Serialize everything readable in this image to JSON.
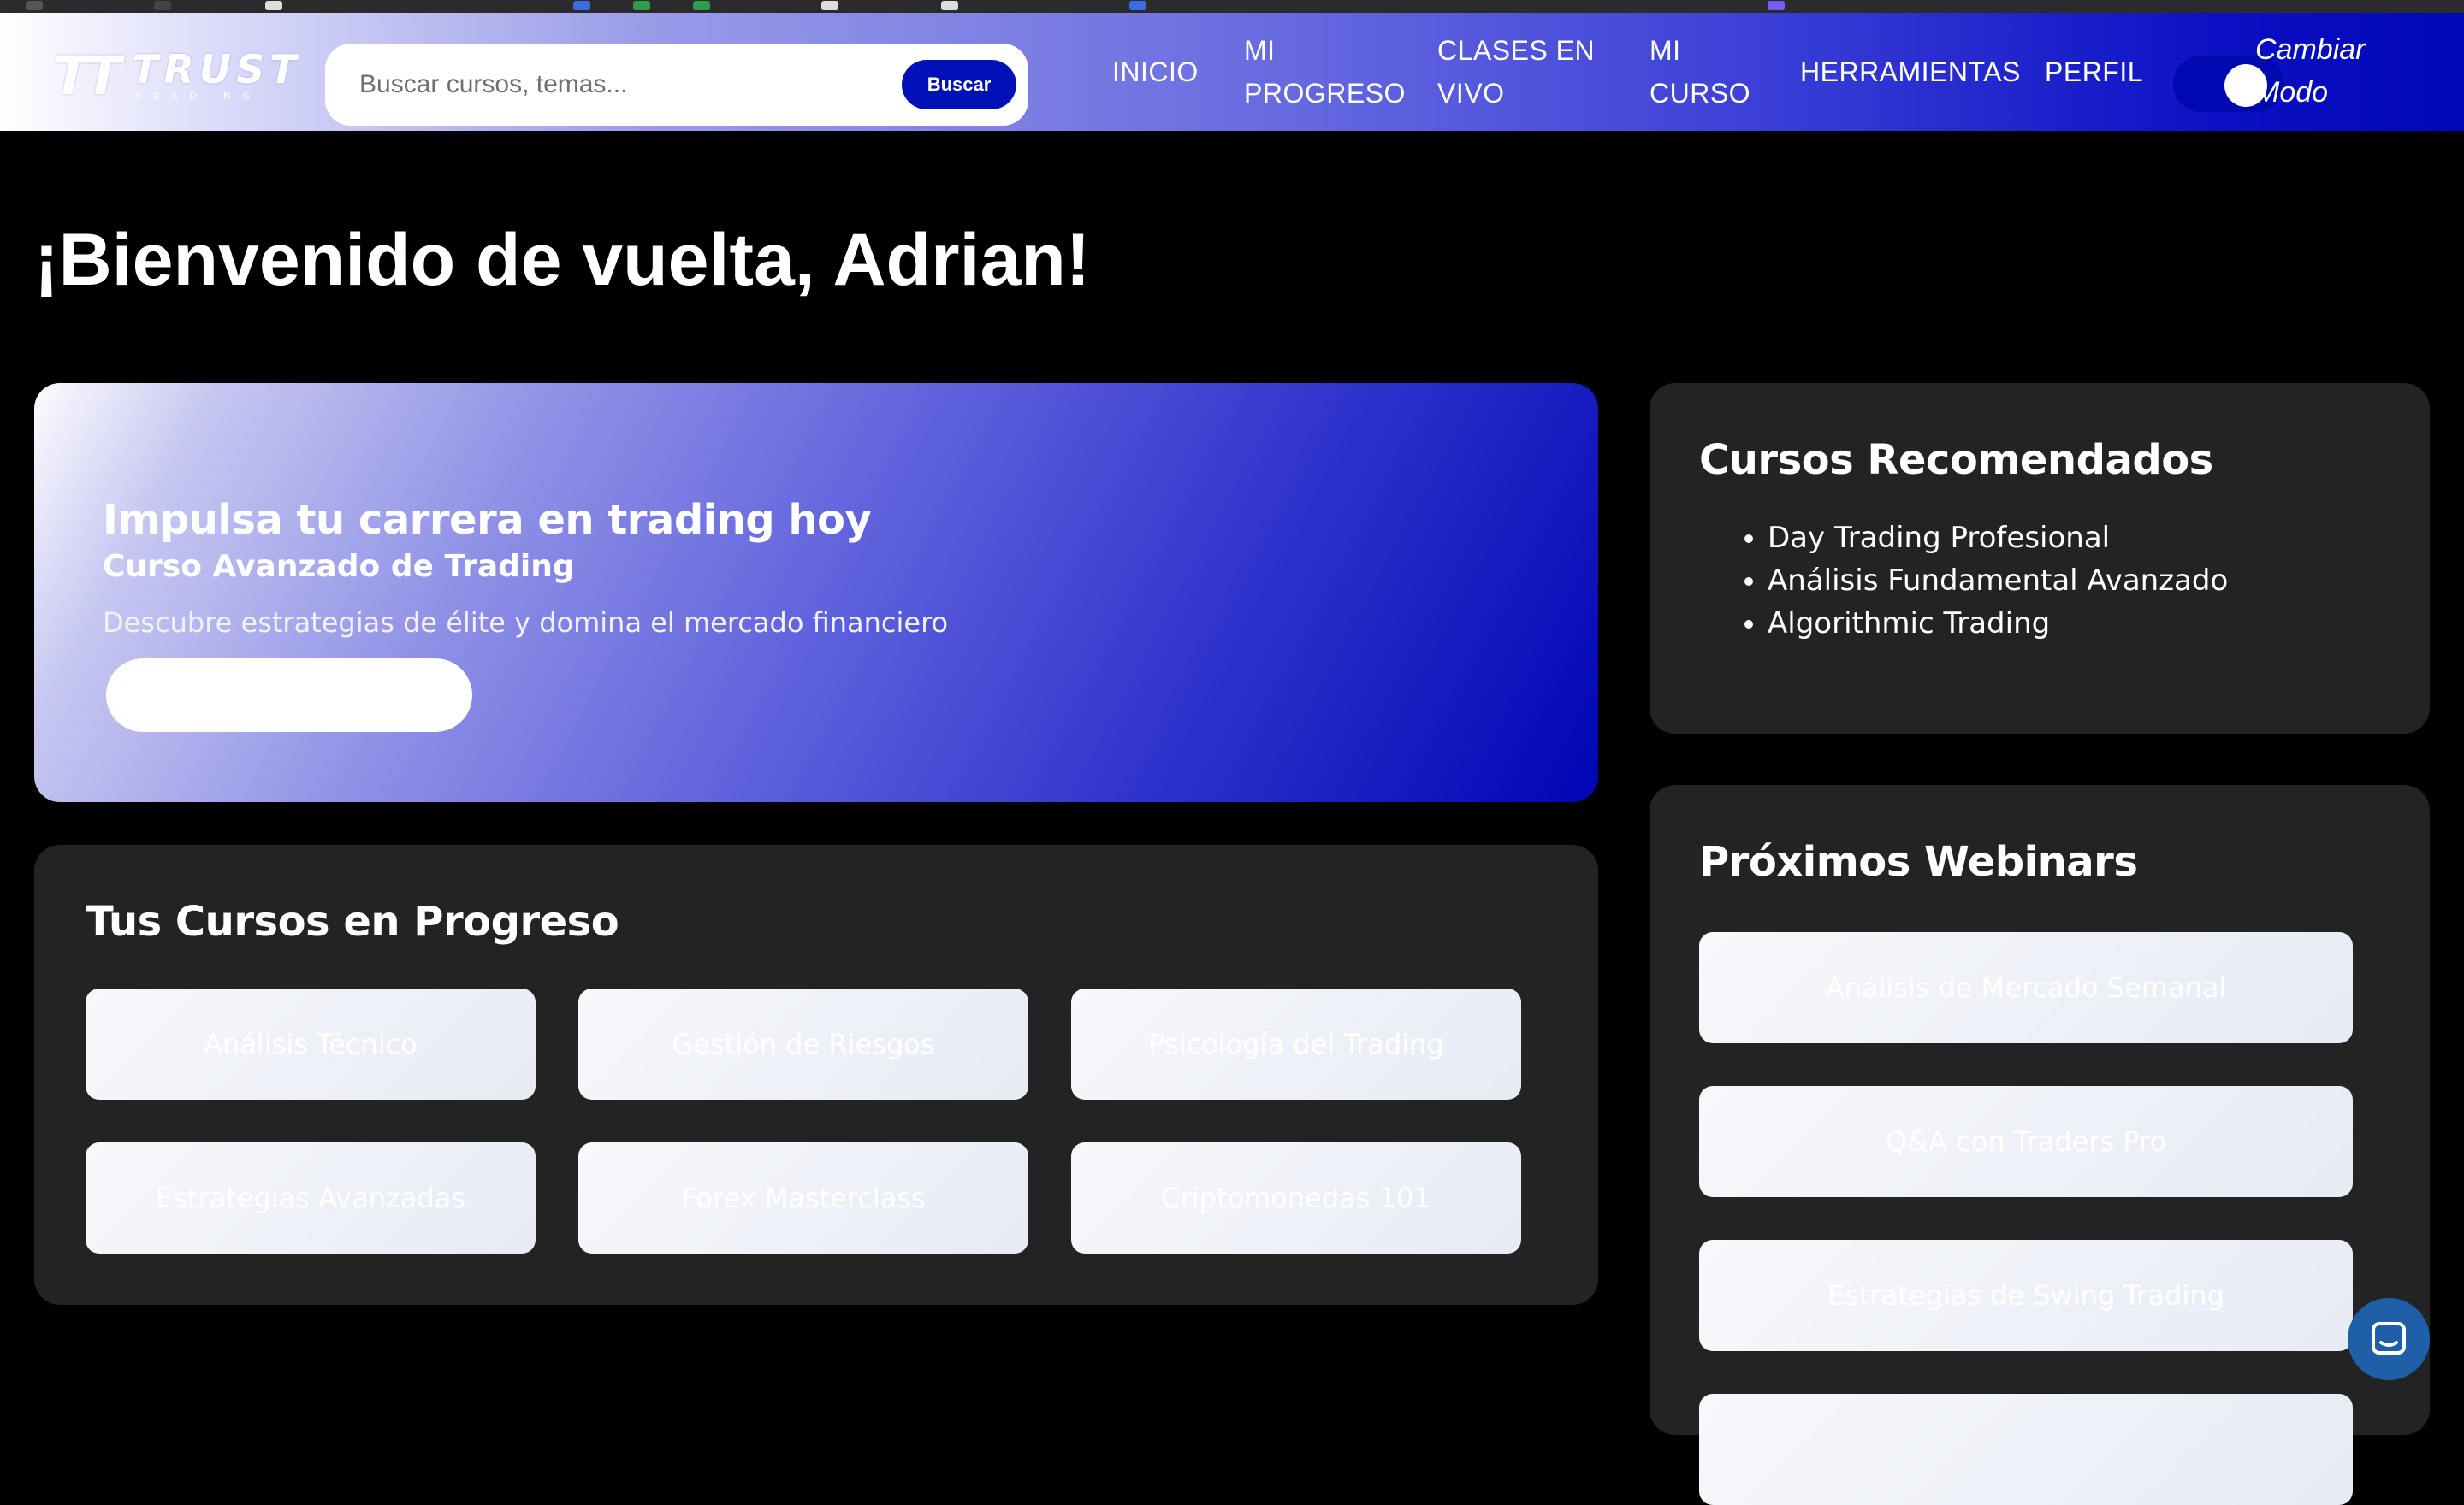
{
  "brand": {
    "mark": "TT",
    "name": "TRUST",
    "tagline": "TRADING"
  },
  "search": {
    "placeholder": "Buscar cursos, temas...",
    "button_label": "Buscar"
  },
  "nav": {
    "inicio": "INICIO",
    "progreso_1": "MI",
    "progreso_2": "PROGRESO",
    "clases_1": "CLASES EN",
    "clases_2": "VIVO",
    "curso_1": "MI",
    "curso_2": "CURSO",
    "herramientas": "HERRAMIENTAS",
    "perfil": "PERFIL"
  },
  "mode_toggle": {
    "label_1": "Cambiar",
    "label_2": "Modo"
  },
  "welcome": "¡Bienvenido de vuelta, Adrian!",
  "hero": {
    "title": "Impulsa tu carrera en trading hoy",
    "subtitle": "Curso Avanzado de Trading",
    "description": "Descubre estrategias de élite y domina el mercado financiero"
  },
  "progress": {
    "title": "Tus Cursos en Progreso",
    "courses": [
      "Análisis Técnico",
      "Gestión de Riesgos",
      "Psicología del Trading",
      "Estrategias Avanzadas",
      "Forex Masterclass",
      "Criptomonedas 101"
    ]
  },
  "recommended": {
    "title": "Cursos Recomendados",
    "items": [
      "Day Trading Profesional",
      "Análisis Fundamental Avanzado",
      "Algorithmic Trading"
    ]
  },
  "webinars": {
    "title": "Próximos Webinars",
    "items": [
      "Análisis de Mercado Semanal",
      "Q&A con Traders Pro",
      "Estrategias de Swing Trading",
      ""
    ]
  },
  "colors": {
    "accent": "#0011b8",
    "panel": "#232323",
    "background": "#000000"
  },
  "icons": {
    "chat": "chat-icon"
  }
}
